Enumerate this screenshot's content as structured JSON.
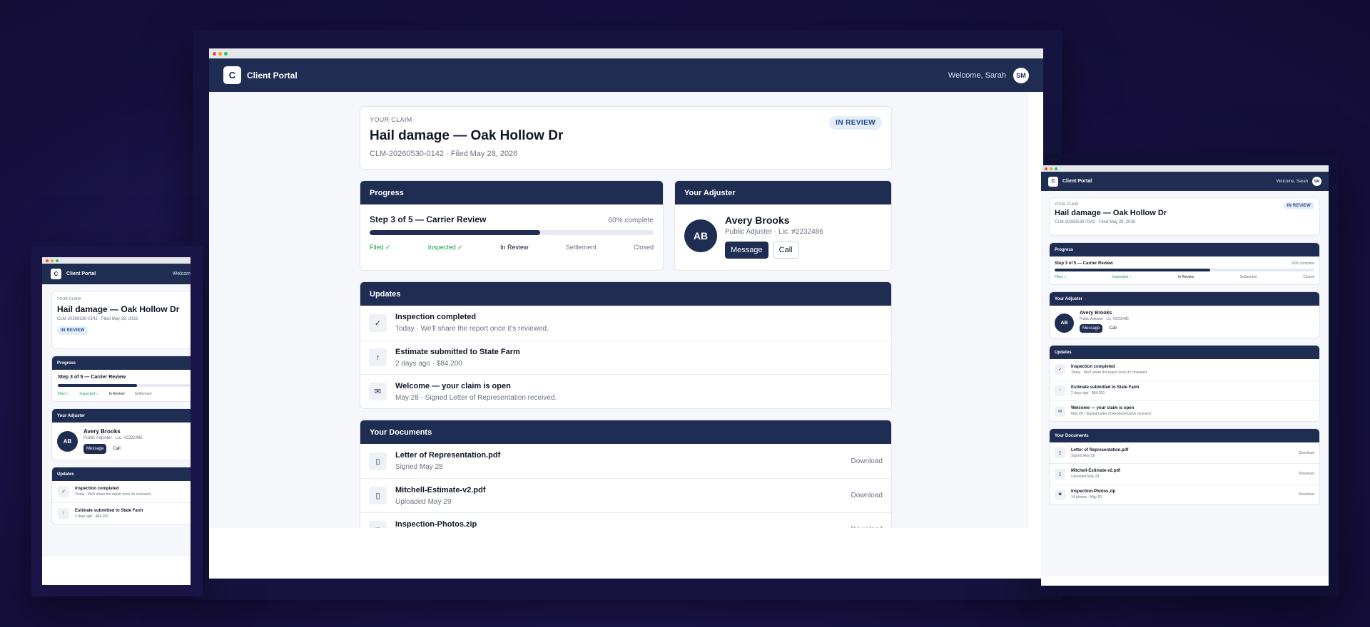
{
  "colors": {
    "navy": "#1f2d52",
    "page_bg": "#f6f7fb",
    "done_green": "#16a34a",
    "badge_bg": "#e4edfa",
    "badge_text": "#1f4a8a",
    "backdrop": "#22195a"
  },
  "app": {
    "logo_letter": "C",
    "brand": "Client Portal",
    "welcome": "Welcome, Sarah",
    "welcome_truncated": "Welcom",
    "user_initials": "SM"
  },
  "claim": {
    "eyebrow": "YOUR CLAIM",
    "title": "Hail damage — Oak Hollow Dr",
    "meta": "CLM-20260530-0142 · Filed May 28, 2026",
    "status": "IN REVIEW"
  },
  "progress": {
    "heading": "Progress",
    "step_text": "Step 3 of 5 — Carrier Review",
    "percent_text": "60% complete",
    "fraction": 0.6,
    "steps": [
      {
        "label": "Filed ✓",
        "state": "done"
      },
      {
        "label": "Inspected ✓",
        "state": "done"
      },
      {
        "label": "In Review",
        "state": "current"
      },
      {
        "label": "Settlement",
        "state": "todo"
      },
      {
        "label": "Closed",
        "state": "todo"
      }
    ]
  },
  "adjuster": {
    "heading": "Your Adjuster",
    "initials": "AB",
    "name": "Avery Brooks",
    "subtitle": "Public Adjuster · Lic. #2232486",
    "message_label": "Message",
    "call_label": "Call"
  },
  "updates": {
    "heading": "Updates",
    "items": [
      {
        "icon": "check-icon",
        "glyph": "✓",
        "title": "Inspection completed",
        "sub": "Today · We'll share the report once it's reviewed."
      },
      {
        "icon": "arrow-up-icon",
        "glyph": "↑",
        "title": "Estimate submitted to State Farm",
        "sub": "2 days ago · $84,200"
      },
      {
        "icon": "mail-icon",
        "glyph": "✉",
        "title": "Welcome — your claim is open",
        "sub": "May 28 · Signed Letter of Representation received."
      }
    ]
  },
  "documents": {
    "heading": "Your Documents",
    "download_label": "Download",
    "items": [
      {
        "icon": "file-icon",
        "glyph": "▯",
        "name": "Letter of Representation.pdf",
        "sub": "Signed May 28"
      },
      {
        "icon": "file-icon",
        "glyph": "▯",
        "name": "Mitchell-Estimate-v2.pdf",
        "sub": "Uploaded May 29"
      },
      {
        "icon": "camera-icon",
        "glyph": "◙",
        "name": "Inspection-Photos.zip",
        "sub": "14 photos · May 30"
      }
    ]
  }
}
